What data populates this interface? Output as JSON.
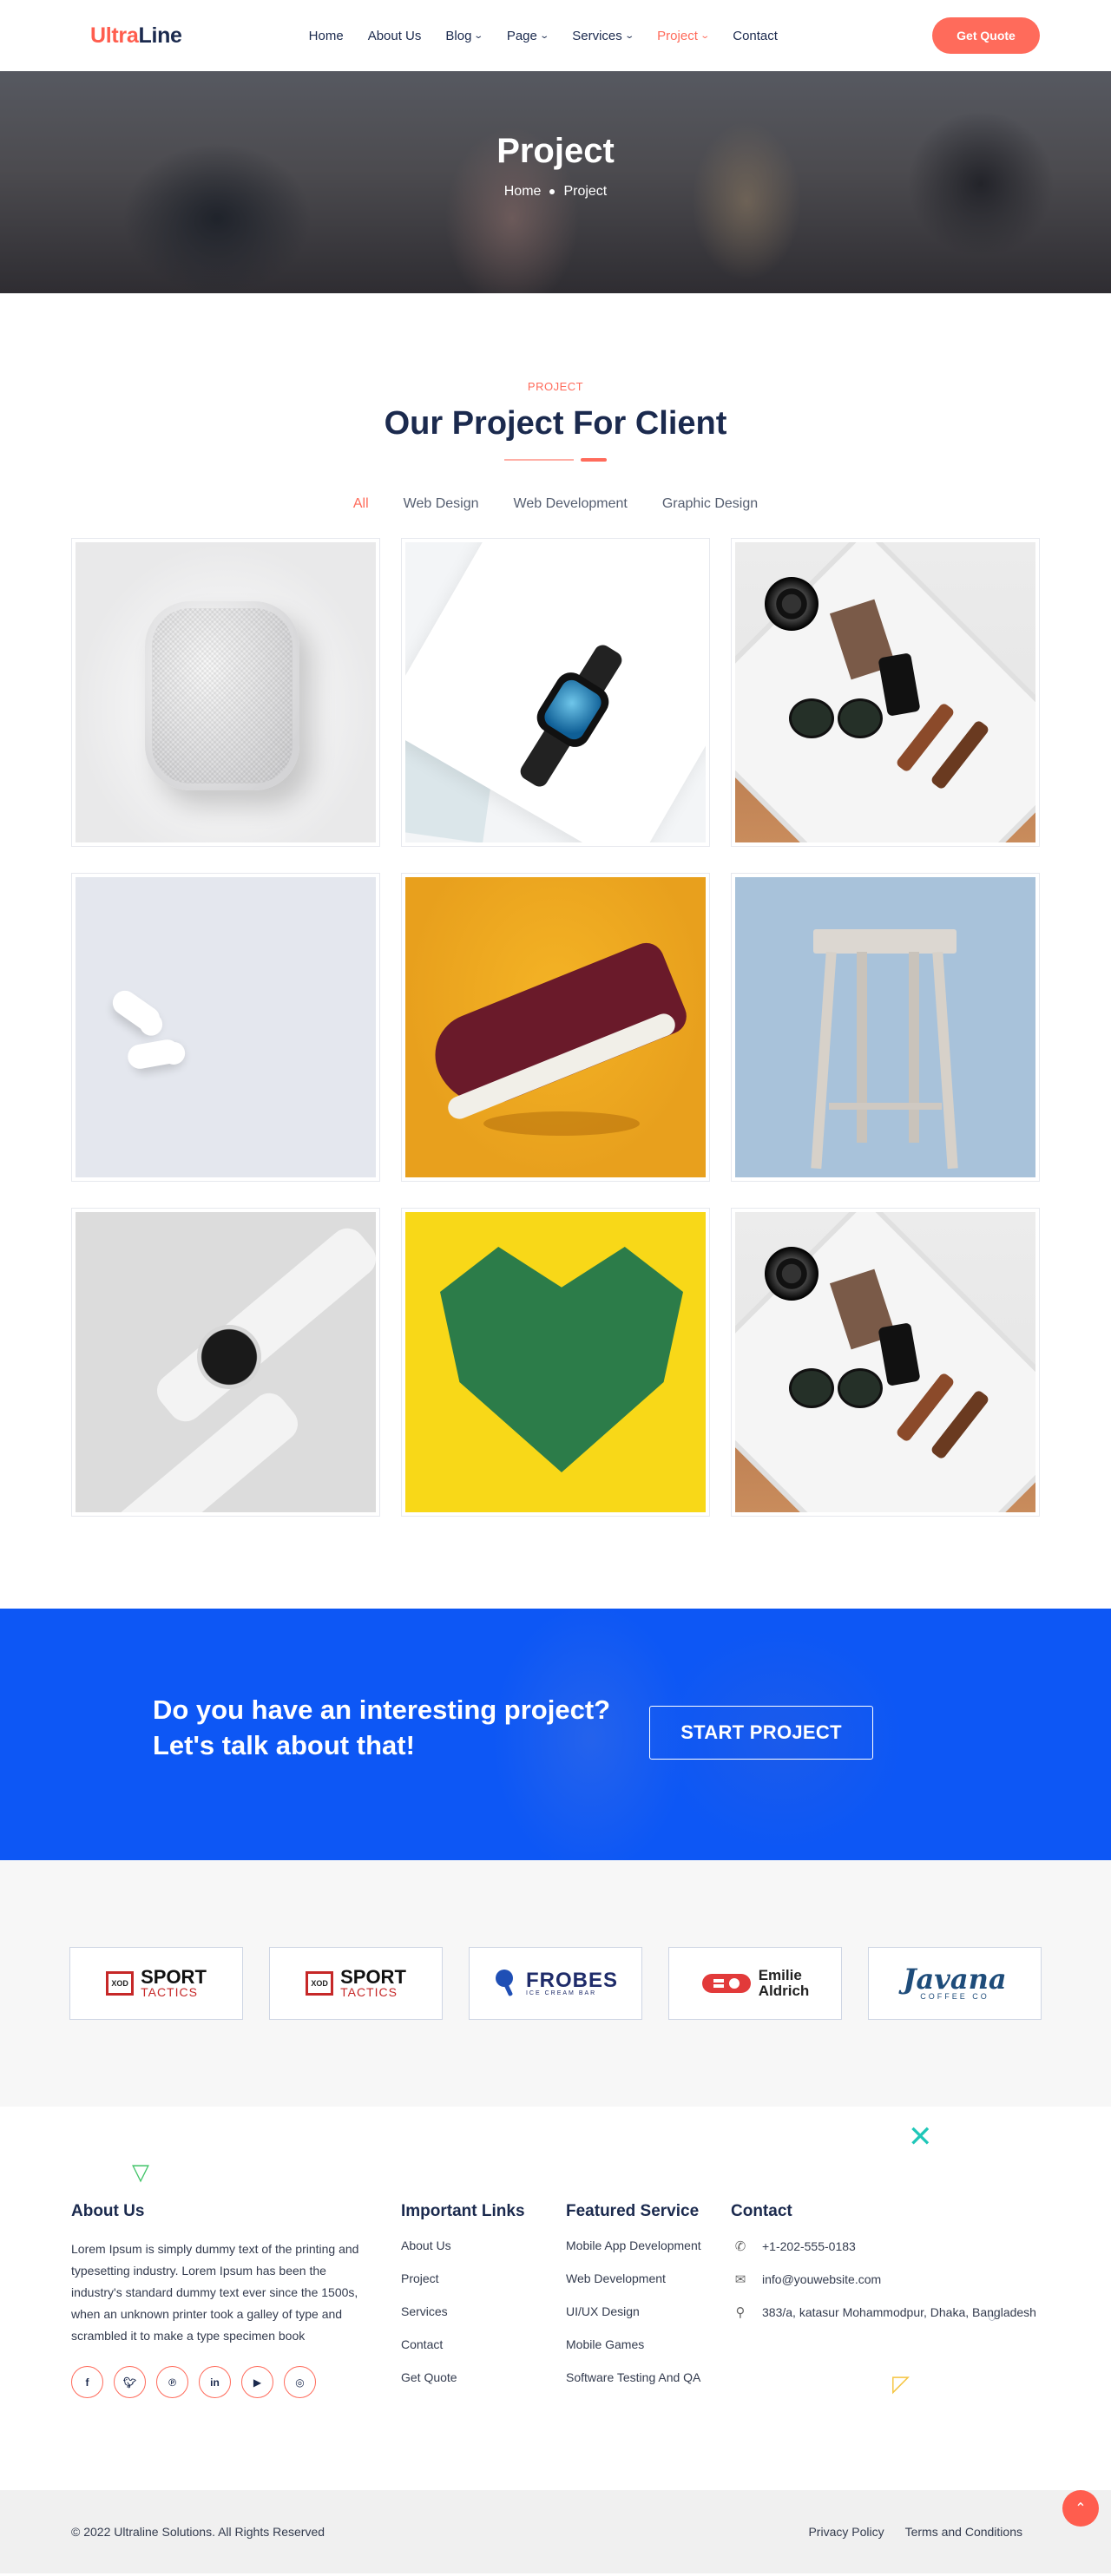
{
  "header": {
    "logo_part1": "Ultra",
    "logo_part2": "Line",
    "nav": [
      {
        "label": "Home"
      },
      {
        "label": "About Us"
      },
      {
        "label": "Blog"
      },
      {
        "label": "Page"
      },
      {
        "label": "Services"
      },
      {
        "label": "Project"
      },
      {
        "label": "Contact"
      }
    ],
    "quote_button": "Get Quote",
    "active_nav": "Project"
  },
  "hero": {
    "title": "Project",
    "breadcrumb": [
      "Home",
      "Project"
    ]
  },
  "projects": {
    "eyebrow": "PROJECT",
    "title": "Our Project For Client",
    "filters": [
      "All",
      "Web Design",
      "Web Development",
      "Graphic Design"
    ],
    "active_filter": "All"
  },
  "cta": {
    "line1": "Do you have an interesting project?",
    "line2": "Let's talk about that!",
    "button": "START PROJECT"
  },
  "brands": {
    "sport_box": "XOD",
    "sport_title": "SPORT",
    "sport_sub": "TACTICS",
    "frobes_title": "FROBES",
    "frobes_sub": "ICE CREAM BAR",
    "emile_line1": "Emilie",
    "emile_line2": "Aldrich",
    "javana_title": "Javana",
    "javana_sub": "COFFEE CO"
  },
  "footer": {
    "about_title": "About Us",
    "about_text": "Lorem Ipsum is simply dummy text of the printing and typesetting industry. Lorem Ipsum has been the industry's standard dummy text ever since the 1500s, when an unknown printer took a galley of type and scrambled it to make a type specimen book",
    "links_title": "Important Links",
    "links": [
      "About Us",
      "Project",
      "Services",
      "Contact",
      "Get Quote"
    ],
    "services_title": "Featured Service",
    "services": [
      "Mobile App Development",
      "Web Development",
      "UI/UX Design",
      "Mobile Games",
      "Software Testing And QA"
    ],
    "contact_title": "Contact",
    "phone": "+1-202-555-0183",
    "email": "info@youwebsite.com",
    "address": "383/a, katasur Mohammodpur, Dhaka, Bangladesh",
    "copyright": "© 2022 Ultraline Solutions. All Rights Reserved",
    "privacy": "Privacy Policy",
    "terms": "Terms and Conditions"
  },
  "colors": {
    "accent": "#ff6b5b",
    "navy": "#1b2a4e",
    "cta_blue": "#0d57f5"
  }
}
